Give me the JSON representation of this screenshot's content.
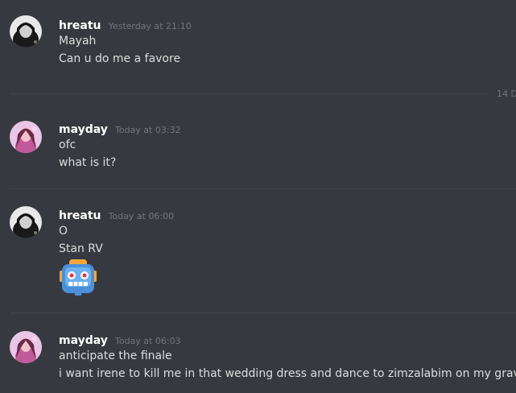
{
  "date_divider": {
    "label": "14 D"
  },
  "messages": [
    {
      "username": "hreatu",
      "timestamp": "Yesterday at 21:10",
      "lines": [
        "Mayah",
        "Can u do me a favore"
      ]
    },
    {
      "username": "mayday",
      "timestamp": "Today at 03:32",
      "lines": [
        "ofc",
        "what is it?"
      ]
    },
    {
      "username": "hreatu",
      "timestamp": "Today at 06:00",
      "lines": [
        "O",
        "Stan RV"
      ],
      "emoji": "robot-emoji"
    },
    {
      "username": "mayday",
      "timestamp": "Today at 06:03",
      "lines": [
        "anticipate the finale",
        "i want irene to kill me in that wedding dress and dance to zimzalabim on my grave"
      ]
    }
  ],
  "colors": {
    "background": "#36393f",
    "username": "#ffffff",
    "timestamp": "#72767d",
    "text": "#dcddde",
    "divider": "#42454a"
  }
}
